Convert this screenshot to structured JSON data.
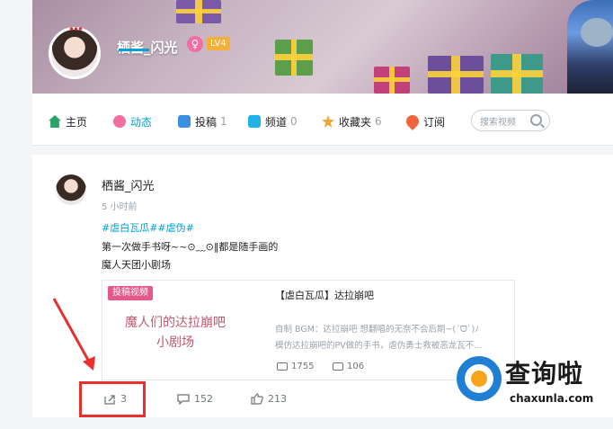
{
  "banner": {
    "username": "栖酱_闪光",
    "gender_symbol": "♀",
    "level": "LV4"
  },
  "nav": {
    "items": [
      {
        "label": "主页",
        "count": "",
        "icon": "home-icon",
        "color": "#2aa36b"
      },
      {
        "label": "动态",
        "count": "",
        "icon": "dynamic-icon",
        "color": "#f06fa0"
      },
      {
        "label": "投稿",
        "count": "1",
        "icon": "upload-icon",
        "color": "#3a8fe0"
      },
      {
        "label": "频道",
        "count": "0",
        "icon": "channel-icon",
        "color": "#22b0e8"
      },
      {
        "label": "收藏夹",
        "count": "6",
        "icon": "favorite-icon",
        "color": "#f3a53a"
      },
      {
        "label": "订阅",
        "count": "",
        "icon": "subscribe-icon",
        "color": "#f0643c"
      }
    ],
    "active_index": 1,
    "search_placeholder": "搜索视频"
  },
  "post": {
    "username": "栖酱_闪光",
    "time": "5 小时前",
    "tags": "#虐白瓦瓜##虐伪#",
    "line1": "第一次做手书呀~~⊙﹏⊙‖都是随手画的",
    "line2": "魔人天团小剧场",
    "video": {
      "badge": "投稿视频",
      "thumb_line1": "魔人们的达拉崩吧",
      "thumb_line2": "小剧场",
      "title": "【虐白瓦瓜】达拉崩吧",
      "desc_line1": "自制 BGM：达拉崩吧 想翻唱的无奈不会后期~(ˊᗜˋ)ﾉ",
      "desc_line2": "模仿达拉崩吧的PV做的手书，虐伪勇士救被恶龙瓦不...",
      "plays": "1755",
      "danmaku": "106"
    },
    "actions": {
      "share": "3",
      "comment": "152",
      "like": "213"
    }
  },
  "watermark": {
    "cn": "查询啦",
    "en": "chaxunla.com"
  },
  "colors": {
    "accent": "#00a1d6",
    "highlight": "#e8302c",
    "badge_pink": "#e45a86"
  }
}
